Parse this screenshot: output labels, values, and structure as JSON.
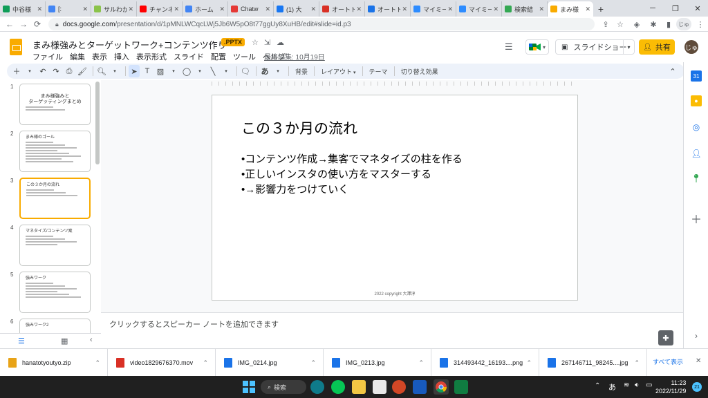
{
  "browser": {
    "tabs": [
      {
        "label": "中谷様",
        "color": "#0f9d58"
      },
      {
        "label": "[:",
        "color": "#4285f4"
      },
      {
        "label": "サルわか",
        "color": "#8bc34a"
      },
      {
        "label": "チャンネ",
        "color": "#ff0000"
      },
      {
        "label": "ホーム",
        "color": "#4285f4"
      },
      {
        "label": "Chatw",
        "color": "#e53935"
      },
      {
        "label": "(1) 大",
        "color": "#1877f2"
      },
      {
        "label": "オートト",
        "color": "#d93025"
      },
      {
        "label": "オートト",
        "color": "#1a73e8"
      },
      {
        "label": "マイミー",
        "color": "#2d8cff"
      },
      {
        "label": "マイミー",
        "color": "#2d8cff"
      },
      {
        "label": "検索結",
        "color": "#34a853"
      },
      {
        "label": "まみ様",
        "color": "#f9ab00",
        "active": true
      }
    ],
    "url_domain": "docs.google.com",
    "url_path": "/presentation/d/1pMNLWCqcLWj5Jb6W5pO8t77ggUy8XuHB/edit#slide=id.p3"
  },
  "app": {
    "title": "まみ様強みとターゲットワーク+コンテンツ作り",
    "badge": ".PPTX",
    "menus": [
      "ファイル",
      "編集",
      "表示",
      "挿入",
      "表示形式",
      "スライド",
      "配置",
      "ツール",
      "ヘルプ"
    ],
    "last_edit": "最終編集: 10月19日",
    "slideshow_label": "スライドショー",
    "share_label": "共有",
    "avatar_text": "じゅ"
  },
  "toolbar": {
    "background_label": "背景",
    "layout_label": "レイアウト",
    "theme_label": "テーマ",
    "transition_label": "切り替え効果"
  },
  "filmstrip": [
    {
      "num": "1",
      "title": "まみ様強みと\nターゲッティングまとめ",
      "lines": 2
    },
    {
      "num": "2",
      "title": "まみ様のゴール",
      "lines": 8
    },
    {
      "num": "3",
      "title": "この３か月の流れ",
      "lines": 3,
      "selected": true
    },
    {
      "num": "4",
      "title": "マネタイズ/コンテンツ案",
      "lines": 4
    },
    {
      "num": "5",
      "title": "強みワーク",
      "lines": 6
    },
    {
      "num": "6",
      "title": "強みワーク2",
      "lines": 0
    }
  ],
  "slide": {
    "title": "この３か月の流れ",
    "bullets": [
      "•コンテンツ作成→集客でマネタイズの柱を作る",
      "•正しいインスタの使い方をマスターする",
      "•→影響力をつけていく"
    ],
    "footer": "2022 copyright 大澤淳"
  },
  "notes": {
    "placeholder": "クリックするとスピーカー ノートを追加できます"
  },
  "downloads": {
    "items": [
      {
        "name": "hanatotyoutyo.zip",
        "color": "#e8a317"
      },
      {
        "name": "video1829676370.mov",
        "color": "#d93025"
      },
      {
        "name": "IMG_0214.jpg",
        "color": "#1a73e8"
      },
      {
        "name": "IMG_0213.jpg",
        "color": "#1a73e8"
      },
      {
        "name": "314493442_16193....png",
        "color": "#1a73e8"
      },
      {
        "name": "267146711_98245....jpg",
        "color": "#1a73e8"
      }
    ],
    "show_all": "すべて表示"
  },
  "taskbar": {
    "search_label": "検索",
    "ime": "あ",
    "time": "11:23",
    "date": "2022/11/29",
    "notif_count": "21"
  }
}
